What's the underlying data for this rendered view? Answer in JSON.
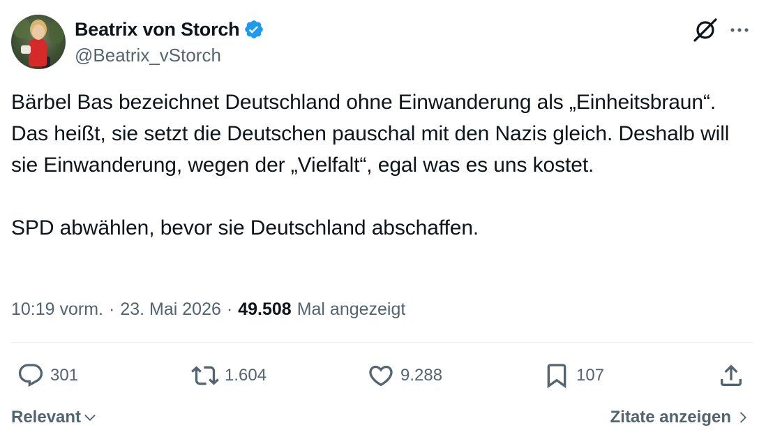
{
  "author": {
    "display_name": "Beatrix von Storch",
    "handle": "@Beatrix_vStorch",
    "verified": true,
    "verified_color": "#1d9bf0"
  },
  "header_icons": {
    "grok": "grok-icon",
    "more": "more-icon"
  },
  "tweet": {
    "paragraph1": "Bärbel Bas bezeichnet Deutschland ohne Einwanderung als „Einheitsbraun“. Das heißt, sie setzt die Deutschen pauschal mit den Nazis gleich. Deshalb will sie Einwanderung, wegen der „Vielfalt“, egal was es uns kostet.",
    "paragraph2": "SPD abwählen, bevor sie Deutschland abschaffen."
  },
  "meta": {
    "time": "10:19 vorm.",
    "separator": "·",
    "date": "23. Mai 2026",
    "views_count": "49.508",
    "views_label": "Mal angezeigt"
  },
  "actions": {
    "replies": "301",
    "reposts": "1.604",
    "likes": "9.288",
    "bookmarks": "107"
  },
  "footer": {
    "sort_label": "Relevant",
    "quotes_label": "Zitate anzeigen"
  },
  "colors": {
    "text": "#0f1419",
    "secondary": "#536471",
    "divider": "#eff3f4"
  }
}
